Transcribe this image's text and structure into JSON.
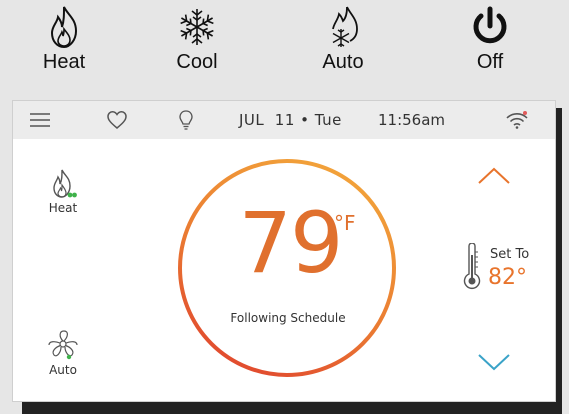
{
  "legend": {
    "heat": {
      "label": "Heat",
      "icon": "flame-icon"
    },
    "cool": {
      "label": "Cool",
      "icon": "snowflake-icon"
    },
    "auto": {
      "label": "Auto",
      "icon": "flame-snowflake-icon"
    },
    "off": {
      "label": "Off",
      "icon": "power-icon"
    }
  },
  "statusbar": {
    "date": "JUL  11 • Tue",
    "time": "11:56am"
  },
  "screen": {
    "system_mode_label": "Heat",
    "fan_mode_label": "Auto",
    "current_temp": "79",
    "unit": "°F",
    "schedule_text": "Following Schedule",
    "set_to_label": "Set To",
    "set_to_value": "82°"
  },
  "colors": {
    "accent_orange": "#e0702e",
    "gradient_start": "#f2a33a",
    "gradient_end": "#e0452e",
    "arrow_down": "#3aa3c8",
    "indicator_green": "#3fb24a"
  }
}
